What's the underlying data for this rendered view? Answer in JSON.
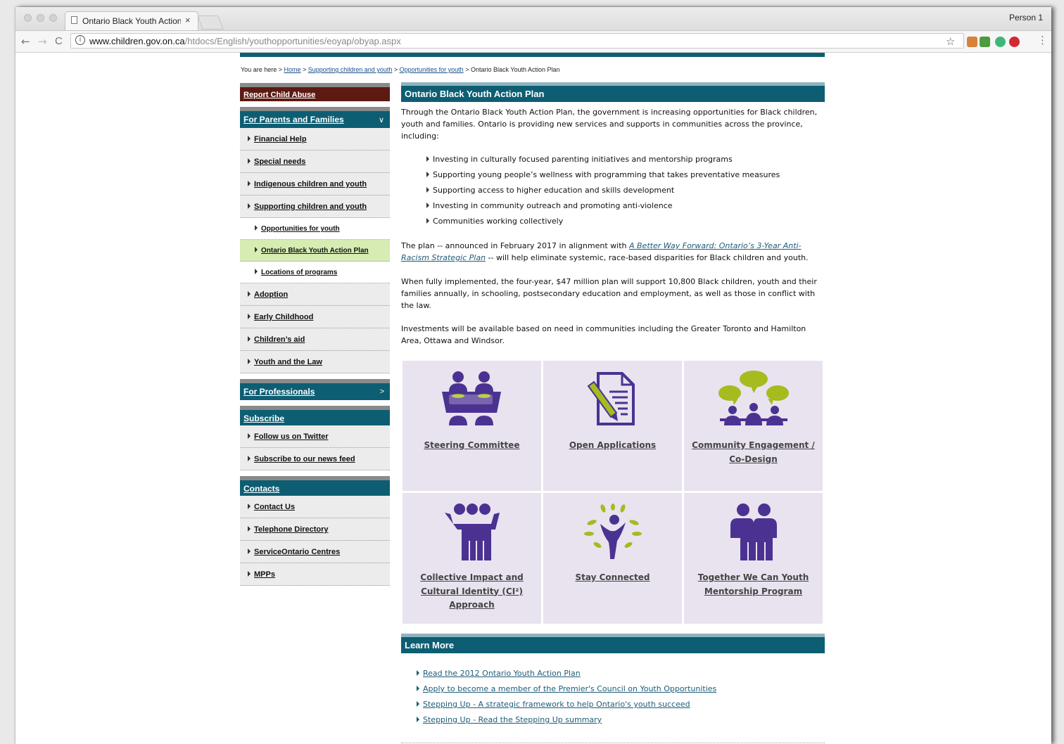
{
  "browser": {
    "tab_title": "Ontario Black Youth Action Pla",
    "tab_close": "×",
    "profile": "Person 1",
    "url_host": "www.children.gov.on.ca",
    "url_path": "/htdocs/English/youthopportunities/eoyap/obyap.aspx",
    "back": "←",
    "forward": "→",
    "reload": "C",
    "star": "☆",
    "info": "i"
  },
  "breadcrumb": {
    "prefix": "You are here > ",
    "home": "Home",
    "sep": " > ",
    "crumb2": "Supporting children and youth",
    "crumb3": "Opportunities for youth",
    "current": "Ontario Black Youth Action Plan"
  },
  "sidebar": {
    "report_abuse": "Report Child Abuse",
    "parents": {
      "heading": "For Parents and Families",
      "chevron": "∨",
      "items": [
        "Financial Help",
        "Special needs",
        "Indigenous children and youth",
        "Supporting children and youth"
      ],
      "subitems": [
        "Opportunities for youth",
        "Ontario Black Youth Action Plan",
        "Locations of programs"
      ],
      "items2": [
        "Adoption",
        "Early Childhood",
        "Children’s aid",
        "Youth and the Law"
      ]
    },
    "professionals": {
      "heading": "For Professionals",
      "chevron": ">"
    },
    "subscribe": {
      "heading": "Subscribe",
      "items": [
        "Follow us on Twitter",
        "Subscribe to our news feed"
      ]
    },
    "contacts": {
      "heading": "Contacts",
      "items": [
        "Contact Us",
        "Telephone Directory",
        "ServiceOntario Centres",
        "MPPs"
      ]
    }
  },
  "main": {
    "title": "Ontario Black Youth Action Plan",
    "intro": "Through the Ontario Black Youth Action Plan, the government is increasing opportunities for Black children, youth and families. Ontario is providing new services and supports in communities across the province, including:",
    "bullets": [
      "Investing in culturally focused parenting initiatives and mentorship programs",
      "Supporting young people’s wellness with programming that takes preventative measures",
      "Supporting access to higher education and skills development",
      "Investing in community outreach and promoting anti-violence",
      "Communities working collectively"
    ],
    "plan_before": "The plan -- announced in February 2017 in alignment with ",
    "plan_link": "A Better Way Forward: Ontario’s 3-Year Anti-Racism Strategic Plan",
    "plan_after": " -- will help eliminate systemic, race-based disparities for Black children and youth.",
    "implemented": "When fully implemented, the four-year, $47 million plan will support 10,800 Black children, youth and their families annually, in schooling, postsecondary education and employment, as well as those in conflict with the law.",
    "investments": "Investments will be available based on need in communities including the Greater Toronto and Hamilton Area, Ottawa and Windsor.",
    "tiles": [
      {
        "label": "Steering Committee",
        "icon": "steering-committee-icon"
      },
      {
        "label": "Open Applications",
        "icon": "document-pen-icon"
      },
      {
        "label": "Community Engagement / Co-Design",
        "icon": "community-speech-icon"
      },
      {
        "label": "Collective Impact and Cultural Identity (CI²) Approach",
        "icon": "group-embrace-icon"
      },
      {
        "label": "Stay Connected",
        "icon": "growing-person-icon"
      },
      {
        "label": "Together We Can Youth Mentorship Program",
        "icon": "mentorship-pair-icon"
      }
    ],
    "learn_more": {
      "title": "Learn More",
      "links": [
        "Read the 2012 Ontario Youth Action Plan",
        "Apply to become a member of the Premier's Council on Youth Opportunities",
        "Stepping Up - A strategic framework to help Ontario's youth succeed",
        "Stepping Up - Read the Stepping Up summary"
      ]
    }
  },
  "colors": {
    "teal": "#0d5e73",
    "maroon": "#5c1a12",
    "purple": "#4b3292",
    "lime": "#a5bb1e",
    "tile_bg": "#e8e3ef",
    "active_nav": "#d6ecb3"
  }
}
